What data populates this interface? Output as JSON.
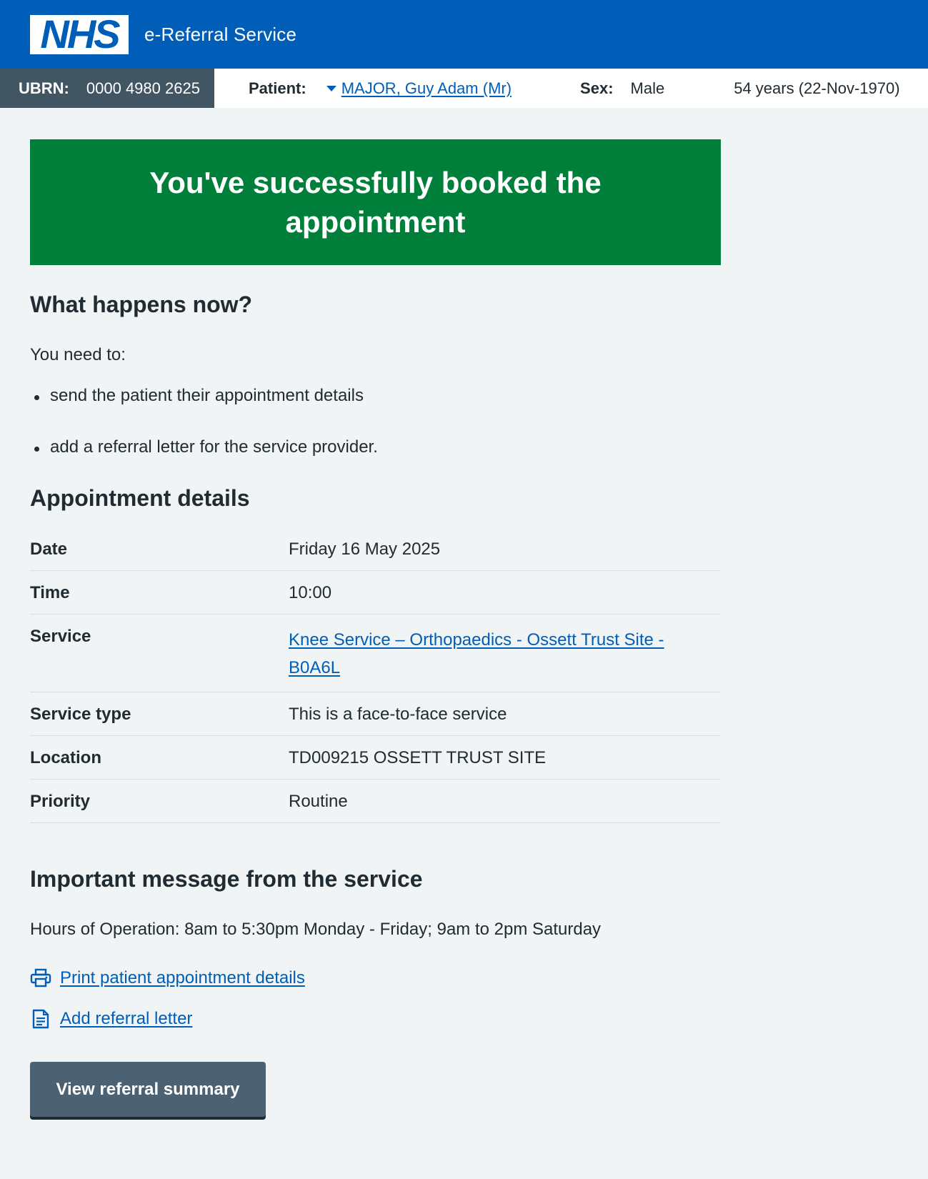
{
  "header": {
    "logo_text": "NHS",
    "service_name": "e-Referral Service",
    "brand_color": "#005eb8"
  },
  "banner": {
    "ubrn_label": "UBRN:",
    "ubrn_value": "0000 4980 2625",
    "patient_label": "Patient:",
    "patient_name": "MAJOR, Guy Adam (Mr)",
    "sex_label": "Sex:",
    "sex_value": "Male",
    "age": "54 years (22-Nov-1970)"
  },
  "success_panel": {
    "title": "You've successfully booked the appointment",
    "color": "#007f3b"
  },
  "next_steps": {
    "heading": "What happens now?",
    "intro": "You need to:",
    "items": [
      "send the patient their appointment details",
      "add a referral letter for the service provider."
    ]
  },
  "appointment": {
    "heading": "Appointment details",
    "rows": [
      {
        "label": "Date",
        "value": "Friday 16 May 2025"
      },
      {
        "label": "Time",
        "value": "10:00"
      },
      {
        "label": "Service",
        "value": "Knee Service – Orthopaedics - Ossett Trust Site - B0A6L"
      },
      {
        "label": "Service type",
        "value": "This is a face-to-face service"
      },
      {
        "label": "Location",
        "value": "TD009215 OSSETT TRUST SITE"
      },
      {
        "label": "Priority",
        "value": "Routine"
      }
    ]
  },
  "message": {
    "heading": "Important message from the service",
    "text": "Hours of Operation: 8am to 5:30pm Monday - Friday; 9am to 2pm Saturday"
  },
  "actions": {
    "print_label": "Print patient appointment details",
    "print_icon": "printer-icon",
    "letter_label": "Add referral letter",
    "letter_icon": "document-icon",
    "button_label": "View referral summary"
  }
}
